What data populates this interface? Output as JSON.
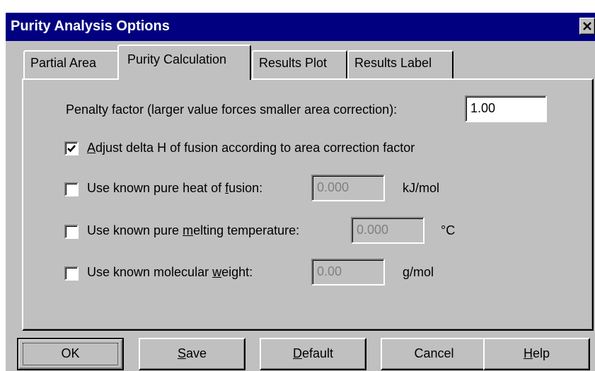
{
  "dialog": {
    "title": "Purity Analysis Options",
    "close_glyph": "×"
  },
  "tabs": [
    {
      "label": "Partial Area",
      "active": false
    },
    {
      "label": "Purity Calculation",
      "active": true
    },
    {
      "label": "Results Plot",
      "active": false
    },
    {
      "label": "Results Label",
      "active": false
    }
  ],
  "penalty": {
    "label": "Penalty factor (larger value forces smaller area correction):",
    "value": "1.00"
  },
  "adjust": {
    "checked": true,
    "mnemonic": "A",
    "label_rest": "djust delta H of fusion according to area correction factor"
  },
  "heat_of_fusion": {
    "checked": false,
    "label_pre": "Use known pure heat of ",
    "mnemonic": "f",
    "label_post": "usion:",
    "value": "0.000",
    "unit": "kJ/mol"
  },
  "melting_temp": {
    "checked": false,
    "label_pre": "Use known pure ",
    "mnemonic": "m",
    "label_post": "elting temperature:",
    "value": "0.000",
    "unit": "°C"
  },
  "molecular_weight": {
    "checked": false,
    "label_pre": "Use known molecular ",
    "mnemonic": "w",
    "label_post": "eight:",
    "value": "0.00",
    "unit": "g/mol"
  },
  "buttons": {
    "ok": "OK",
    "save_mnemonic": "S",
    "save_rest": "ave",
    "default_mnemonic": "D",
    "default_rest": "efault",
    "cancel": "Cancel",
    "help_mnemonic": "H",
    "help_rest": "elp"
  },
  "colors": {
    "titlebar": "#000080",
    "face": "#c0c0c0"
  }
}
